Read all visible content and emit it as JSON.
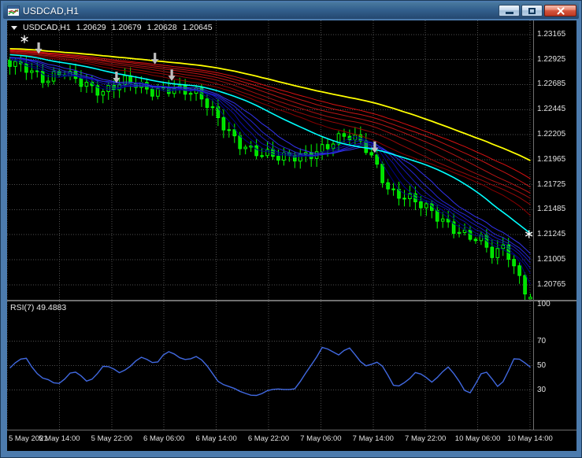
{
  "window": {
    "title": "USDCAD,H1"
  },
  "chart": {
    "info": {
      "symbol": "USDCAD,H1",
      "open": "1.20629",
      "high": "1.20679",
      "low": "1.20628",
      "close": "1.20645"
    },
    "price_ticks": [
      "1.23165",
      "1.22925",
      "1.22685",
      "1.22445",
      "1.22205",
      "1.21965",
      "1.21725",
      "1.21485",
      "1.21245",
      "1.21005",
      "1.20765"
    ],
    "time_ticks": [
      "5 May 2021",
      "5 May 14:00",
      "5 May 22:00",
      "6 May 06:00",
      "6 May 14:00",
      "6 May 22:00",
      "7 May 06:00",
      "7 May 14:00",
      "7 May 22:00",
      "10 May 06:00",
      "10 May 14:00"
    ]
  },
  "rsi_panel": {
    "label": "RSI(7) 49.4883",
    "scale_labels": [
      "100",
      "70",
      "50",
      "30"
    ]
  },
  "chart_data": {
    "type": "candlestick",
    "symbol": "USDCAD",
    "timeframe": "H1",
    "last_ohlc": {
      "open": 1.20629,
      "high": 1.20679,
      "low": 1.20628,
      "close": 1.20645
    },
    "y_axis": {
      "range": [
        1.2062,
        1.233
      ],
      "ticks": [
        1.23165,
        1.22925,
        1.22685,
        1.22445,
        1.22205,
        1.21965,
        1.21725,
        1.21485,
        1.21245,
        1.21005,
        1.20765
      ]
    },
    "x_axis": {
      "labels": [
        "5 May 2021",
        "5 May 14:00",
        "5 May 22:00",
        "6 May 06:00",
        "6 May 14:00",
        "6 May 22:00",
        "7 May 06:00",
        "7 May 14:00",
        "7 May 22:00",
        "10 May 06:00",
        "10 May 14:00"
      ],
      "grid_hours": 8
    },
    "visible_candles": 96,
    "close_path_anchors": [
      [
        -0.9,
        1.2309
      ],
      [
        -0.5,
        1.2306
      ],
      [
        -0.2,
        1.23
      ],
      [
        0,
        1.2292
      ],
      [
        0.03,
        1.2288
      ],
      [
        0.07,
        1.227
      ],
      [
        0.1,
        1.2278
      ],
      [
        0.14,
        1.2272
      ],
      [
        0.18,
        1.2263
      ],
      [
        0.22,
        1.227
      ],
      [
        0.27,
        1.2262
      ],
      [
        0.31,
        1.2268
      ],
      [
        0.36,
        1.2258
      ],
      [
        0.4,
        1.2235
      ],
      [
        0.44,
        1.2215
      ],
      [
        0.48,
        1.2202
      ],
      [
        0.52,
        1.2196
      ],
      [
        0.56,
        1.2201
      ],
      [
        0.6,
        1.2209
      ],
      [
        0.645,
        1.2218
      ],
      [
        0.68,
        1.221
      ],
      [
        0.7,
        1.2196
      ],
      [
        0.73,
        1.2168
      ],
      [
        0.76,
        1.2161
      ],
      [
        0.79,
        1.2151
      ],
      [
        0.82,
        1.2141
      ],
      [
        0.85,
        1.2133
      ],
      [
        0.88,
        1.2126
      ],
      [
        0.905,
        1.2119
      ],
      [
        0.93,
        1.2101
      ],
      [
        0.95,
        1.2112
      ],
      [
        0.97,
        1.2091
      ],
      [
        1.0,
        1.20645
      ]
    ],
    "indicators": {
      "ma_fast_periods": [
        4,
        6,
        8,
        10,
        12,
        15
      ],
      "ma_medium_period": 26,
      "ma_slow_periods": [
        34,
        40,
        46,
        52,
        58,
        64
      ],
      "ma_slowest_period": 80,
      "rsi": {
        "period": 7,
        "current": 49.4883,
        "range": [
          0,
          100
        ],
        "levels": [
          70,
          50,
          30
        ],
        "anchors": [
          [
            0,
            48
          ],
          [
            0.03,
            57
          ],
          [
            0.06,
            40
          ],
          [
            0.09,
            34
          ],
          [
            0.12,
            46
          ],
          [
            0.15,
            36
          ],
          [
            0.18,
            50
          ],
          [
            0.21,
            44
          ],
          [
            0.25,
            56
          ],
          [
            0.28,
            52
          ],
          [
            0.3,
            62
          ],
          [
            0.33,
            55
          ],
          [
            0.36,
            58
          ],
          [
            0.4,
            38
          ],
          [
            0.44,
            28
          ],
          [
            0.48,
            26
          ],
          [
            0.52,
            32
          ],
          [
            0.55,
            30
          ],
          [
            0.58,
            52
          ],
          [
            0.6,
            65
          ],
          [
            0.63,
            58
          ],
          [
            0.65,
            67
          ],
          [
            0.68,
            48
          ],
          [
            0.71,
            55
          ],
          [
            0.74,
            30
          ],
          [
            0.78,
            45
          ],
          [
            0.81,
            36
          ],
          [
            0.84,
            50
          ],
          [
            0.88,
            26
          ],
          [
            0.91,
            46
          ],
          [
            0.94,
            32
          ],
          [
            0.97,
            56
          ],
          [
            1.0,
            49.5
          ]
        ]
      }
    },
    "markers": {
      "down_arrows": [
        {
          "t": 0.06,
          "price": 1.2298
        },
        {
          "t": 0.208,
          "price": 1.227
        },
        {
          "t": 0.281,
          "price": 1.2288
        },
        {
          "t": 0.313,
          "price": 1.2272
        },
        {
          "t": 0.699,
          "price": 1.2203
        }
      ],
      "stars": [
        {
          "t": 0.033,
          "price": 1.2312
        },
        {
          "t": 0.992,
          "price": 1.2125
        }
      ]
    },
    "colors": {
      "background": "#000000",
      "grid": "#4f4f4f",
      "candle_up_stroke": "#00ff00",
      "candle_up_fill": "#000000",
      "candle_down_fill": "#00dd00",
      "ma_fast": [
        "#00007f",
        "#00008b",
        "#0d0da6",
        "#1a1abf",
        "#2626d8",
        "#3333f0"
      ],
      "ma_medium": "#00ffff",
      "ma_slow": [
        "#8b0000",
        "#990909",
        "#a81010",
        "#b81414",
        "#c91414",
        "#da1111"
      ],
      "ma_slowest": "#ffff00",
      "rsi_line": "#4169e1",
      "marker": "#c0c0c0",
      "axis_text": "#e2e2e2"
    }
  }
}
